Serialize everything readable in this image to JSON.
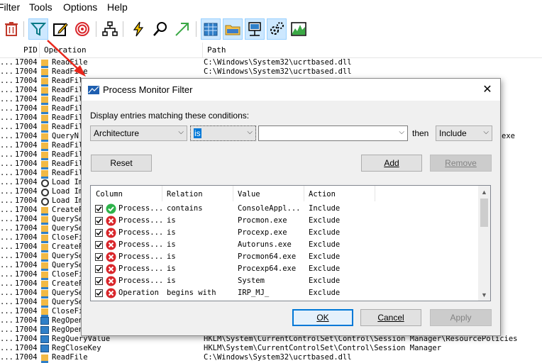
{
  "menu": [
    "Filter",
    "Tools",
    "Options",
    "Help"
  ],
  "toolbar_icons": [
    "delete-icon",
    "filter-icon",
    "highlight-icon",
    "target-icon",
    "process-tree-icon",
    "jump-icon",
    "find-icon",
    "jump-to-icon",
    "registry-icon",
    "filesystem-icon",
    "network-icon",
    "process-activity-icon",
    "profiling-icon"
  ],
  "columns": {
    "pid": "PID",
    "operation": "Operation",
    "path": "Path"
  },
  "rows": [
    {
      "d": "...",
      "pid": "17004",
      "op": "ReadFile",
      "path": "C:\\Windows\\System32\\ucrtbased.dll"
    },
    {
      "d": "...",
      "pid": "17004",
      "op": "ReadFile",
      "path": "C:\\Windows\\System32\\ucrtbased.dll"
    },
    {
      "d": "...",
      "pid": "17004",
      "op": "ReadFil",
      "path": ""
    },
    {
      "d": "...",
      "pid": "17004",
      "op": "ReadFil",
      "path": ""
    },
    {
      "d": "...",
      "pid": "17004",
      "op": "ReadFil",
      "path": ""
    },
    {
      "d": "...",
      "pid": "17004",
      "op": "ReadFil",
      "path": ""
    },
    {
      "d": "...",
      "pid": "17004",
      "op": "ReadFil",
      "path": ""
    },
    {
      "d": "...",
      "pid": "17004",
      "op": "ReadFil",
      "path": ""
    },
    {
      "d": "...",
      "pid": "17004",
      "op": "QueryN",
      "path": "exe"
    },
    {
      "d": "...",
      "pid": "17004",
      "op": "ReadFil",
      "path": ""
    },
    {
      "d": "...",
      "pid": "17004",
      "op": "ReadFil",
      "path": ""
    },
    {
      "d": "...",
      "pid": "17004",
      "op": "ReadFil",
      "path": ""
    },
    {
      "d": "...",
      "pid": "17004",
      "op": "ReadFil",
      "path": ""
    },
    {
      "d": "...",
      "pid": "17004",
      "op": "Load Im",
      "path": ""
    },
    {
      "d": "...",
      "pid": "17004",
      "op": "Load Im",
      "path": ""
    },
    {
      "d": "...",
      "pid": "17004",
      "op": "Load Im",
      "path": ""
    },
    {
      "d": "...",
      "pid": "17004",
      "op": "CreateF",
      "path": ""
    },
    {
      "d": "...",
      "pid": "17004",
      "op": "QuerySe",
      "path": ""
    },
    {
      "d": "...",
      "pid": "17004",
      "op": "QuerySe",
      "path": ""
    },
    {
      "d": "...",
      "pid": "17004",
      "op": "CloseFi",
      "path": ""
    },
    {
      "d": "...",
      "pid": "17004",
      "op": "CreateF",
      "path": ""
    },
    {
      "d": "...",
      "pid": "17004",
      "op": "QuerySe",
      "path": ""
    },
    {
      "d": "...",
      "pid": "17004",
      "op": "QuerySe",
      "path": ""
    },
    {
      "d": "...",
      "pid": "17004",
      "op": "CloseFi",
      "path": ""
    },
    {
      "d": "...",
      "pid": "17004",
      "op": "CreateF",
      "path": ""
    },
    {
      "d": "...",
      "pid": "17004",
      "op": "QuerySe",
      "path": ""
    },
    {
      "d": "...",
      "pid": "17004",
      "op": "QuerySe",
      "path": ""
    },
    {
      "d": "...",
      "pid": "17004",
      "op": "CloseFi",
      "path": ""
    },
    {
      "d": "...",
      "pid": "17004",
      "op": "RegOpen",
      "path": ""
    },
    {
      "d": "...",
      "pid": "17004",
      "op": "RegOpen",
      "path": ""
    },
    {
      "d": "...",
      "pid": "17004",
      "op": "RegQueryValue",
      "path": "HKLM\\System\\CurrentControlSet\\Control\\Session Manager\\ResourcePolicies"
    },
    {
      "d": "...",
      "pid": "17004",
      "op": "RegCloseKey",
      "path": "HKLM\\System\\CurrentControlSet\\Control\\Session Manager"
    },
    {
      "d": "...",
      "pid": "17004",
      "op": "ReadFile",
      "path": "C:\\Windows\\System32\\ucrtbased.dll"
    }
  ],
  "dialog": {
    "title": "Process Monitor Filter",
    "prompt": "Display entries matching these conditions:",
    "column_value": "Architecture",
    "relation_value": "is",
    "value_text": "",
    "then_label": "then",
    "action_value": "Include",
    "reset": "Reset",
    "add": "Add",
    "remove": "Remove",
    "headers": {
      "column": "Column",
      "relation": "Relation",
      "value": "Value",
      "action": "Action"
    },
    "filters": [
      {
        "col": "Process...",
        "rel": "contains",
        "val": "ConsoleAppl...",
        "act": "Include",
        "status": "include"
      },
      {
        "col": "Process...",
        "rel": "is",
        "val": "Procmon.exe",
        "act": "Exclude",
        "status": "exclude"
      },
      {
        "col": "Process...",
        "rel": "is",
        "val": "Procexp.exe",
        "act": "Exclude",
        "status": "exclude"
      },
      {
        "col": "Process...",
        "rel": "is",
        "val": "Autoruns.exe",
        "act": "Exclude",
        "status": "exclude"
      },
      {
        "col": "Process...",
        "rel": "is",
        "val": "Procmon64.exe",
        "act": "Exclude",
        "status": "exclude"
      },
      {
        "col": "Process...",
        "rel": "is",
        "val": "Procexp64.exe",
        "act": "Exclude",
        "status": "exclude"
      },
      {
        "col": "Process...",
        "rel": "is",
        "val": "System",
        "act": "Exclude",
        "status": "exclude"
      },
      {
        "col": "Operation",
        "rel": "begins with",
        "val": "IRP_MJ_",
        "act": "Exclude",
        "status": "exclude"
      }
    ],
    "ok": "OK",
    "cancel": "Cancel",
    "apply": "Apply"
  },
  "colors": {
    "accent": "#0078d7",
    "arrow": "#e8261b",
    "include": "#2db34a",
    "exclude": "#d9262b"
  }
}
